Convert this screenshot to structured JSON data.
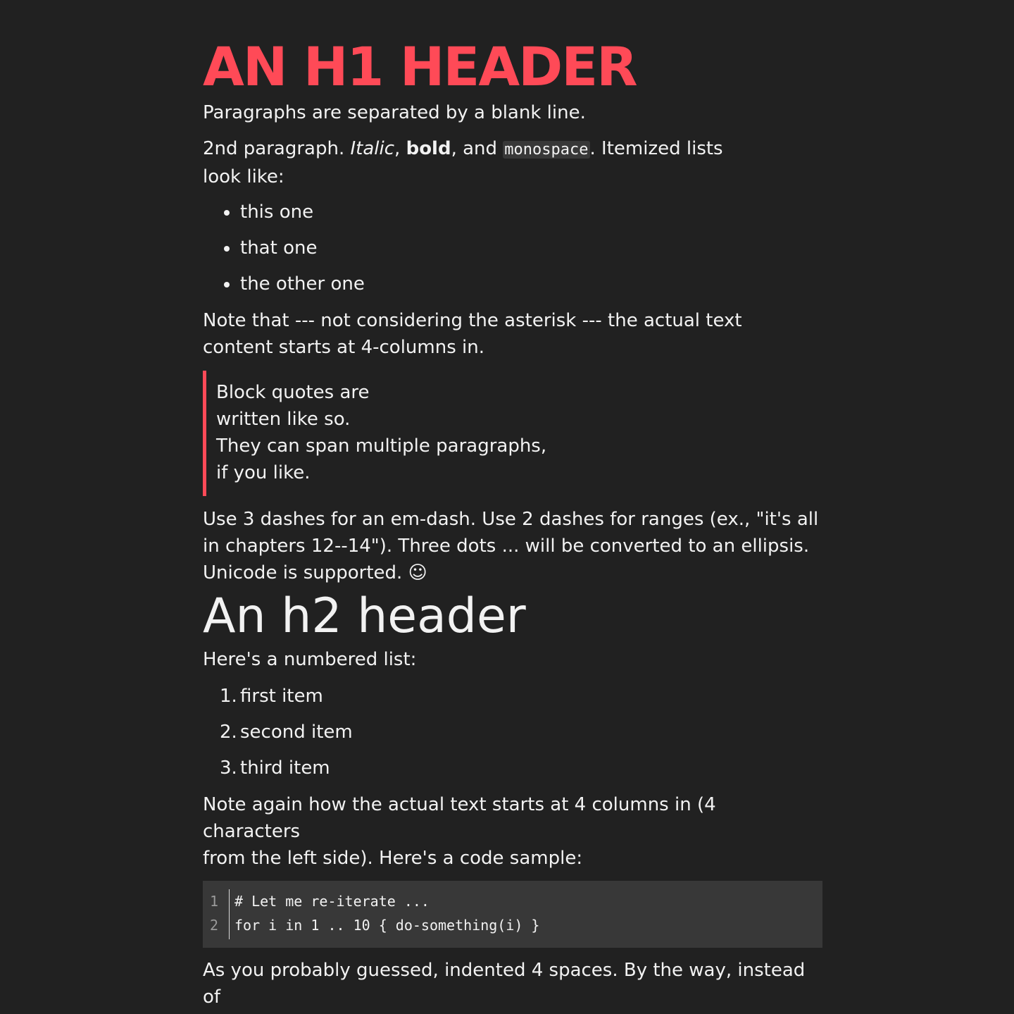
{
  "heading1": "AN H1 HEADER",
  "paragraph1": "Paragraphs are separated by a blank line.",
  "paragraph2": {
    "prefix": "2nd paragraph. ",
    "italic": "Italic",
    "sep1": ", ",
    "bold": "bold",
    "sep2": ", and ",
    "monospace": "monospace",
    "suffix": ". Itemized lists",
    "line2": "look like:"
  },
  "bullet_list": [
    "this one",
    "that one",
    "the other one"
  ],
  "note1": {
    "line1": "Note that --- not considering the asterisk --- the actual text",
    "line2": "content starts at 4-columns in."
  },
  "blockquote": {
    "line1": "Block quotes are",
    "line2": "written like so.",
    "line3": "They can span multiple paragraphs,",
    "line4": "if you like."
  },
  "dashes_paragraph": {
    "line1": "Use 3 dashes for an em-dash. Use 2 dashes for ranges (ex., \"it's all",
    "line2": "in chapters 12--14\"). Three dots ... will be converted to an ellipsis.",
    "line3": "Unicode is supported. ☺"
  },
  "heading2": "An h2 header",
  "numbered_intro": "Here's a numbered list:",
  "numbered_list": [
    {
      "num": "1.",
      "text": "first item"
    },
    {
      "num": "2.",
      "text": "second item"
    },
    {
      "num": "3.",
      "text": "third item"
    }
  ],
  "note2": {
    "line1": "Note again how the actual text starts at 4 columns in (4",
    "line2": "characters",
    "line3": "from the left side). Here's a code sample:"
  },
  "code_sample": {
    "line_numbers": [
      "1",
      "2"
    ],
    "lines": [
      "# Let me re-iterate ...",
      "for i in 1 .. 10 { do-something(i) }"
    ]
  },
  "closing": {
    "line1": "As you probably guessed, indented 4 spaces. By the way, instead",
    "line2": "of"
  }
}
